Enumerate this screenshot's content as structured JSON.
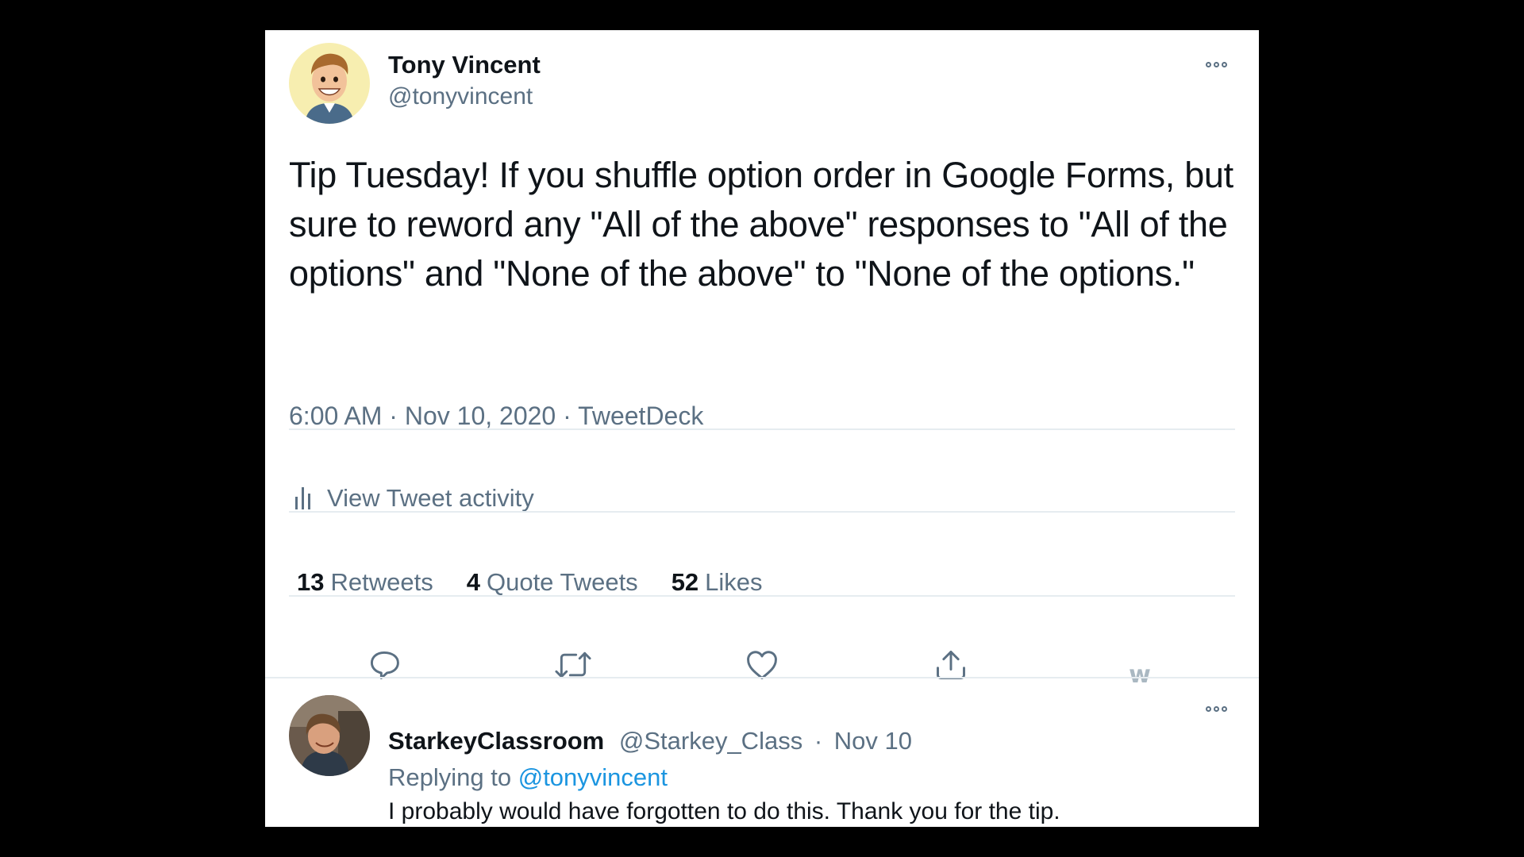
{
  "tweet": {
    "author_name": "Tony Vincent",
    "author_handle": "@tonyvincent",
    "text": "Tip Tuesday! If you shuffle option order in Google Forms, but sure to reword any \"All of the above\" responses to \"All of the options\" and \"None of the above\" to \"None of the options.\"",
    "time": "6:00 AM",
    "date": "Nov 10, 2020",
    "source": "TweetDeck",
    "separator": "·",
    "more_icon": "more-horizontal-icon"
  },
  "activity": {
    "label": "View Tweet activity",
    "icon": "bar-chart-icon"
  },
  "stats": {
    "retweets_count": "13",
    "retweets_label": "Retweets",
    "quotes_count": "4",
    "quotes_label": "Quote Tweets",
    "likes_count": "52",
    "likes_label": "Likes"
  },
  "actions": {
    "icons": [
      "reply-icon",
      "retweet-icon",
      "like-icon",
      "share-icon",
      "w-logo-icon"
    ],
    "w_logo_text": "w"
  },
  "reply": {
    "author_name": "StarkeyClassroom",
    "author_handle": "@Starkey_Class",
    "separator": "·",
    "date": "Nov 10",
    "replying_to_label": "Replying to",
    "replying_to_handle": "@tonyvincent",
    "text": "I probably would have forgotten to do this. Thank you for the tip."
  },
  "colors": {
    "background": "#000000",
    "card": "#ffffff",
    "primary_text": "#0f1419",
    "secondary_text": "#5b7083",
    "link": "#1b95e0",
    "divider": "#e6ecf0"
  }
}
